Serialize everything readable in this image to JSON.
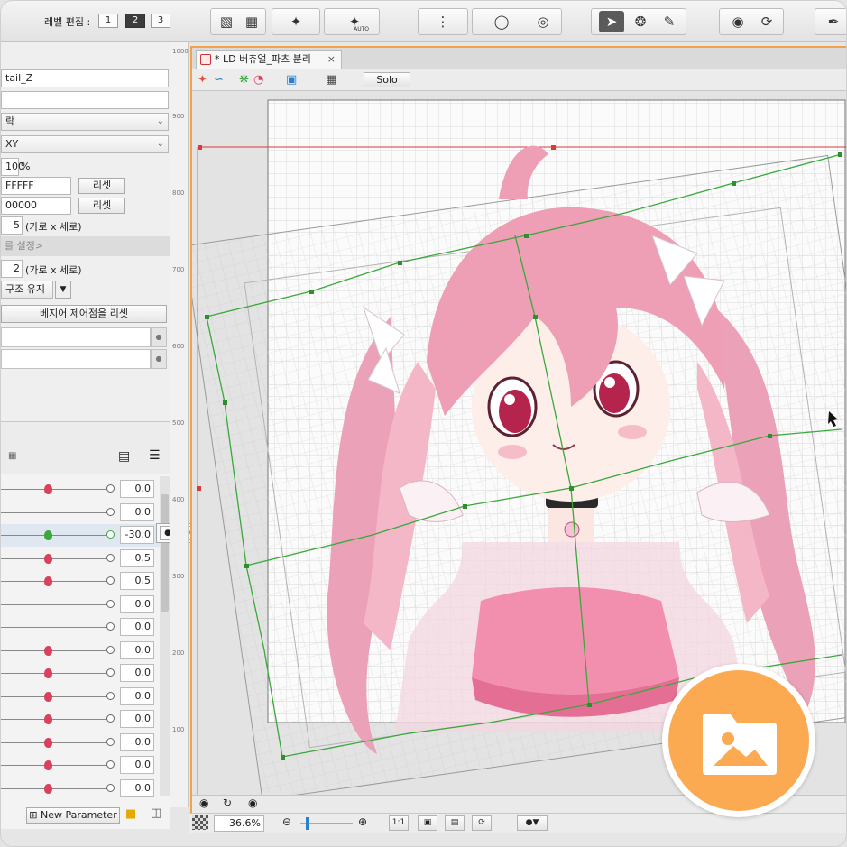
{
  "toolbar": {
    "level_edit_label": "레벨 편집 :",
    "levels": [
      "1",
      "2",
      "3"
    ],
    "active_level": "2",
    "auto_label": "AUTO"
  },
  "inspector": {
    "name_value": "tail_Z",
    "dropdown1": "락",
    "dropdown2": "XY",
    "opacity": "100",
    "opacity_unit": "%",
    "color1": "FFFFF",
    "color2": "00000",
    "reset_label": "리셋",
    "divisions1": "5",
    "divisions_unit": "(가로 x 세로)",
    "section_label": "를 설정>",
    "divisions2": "2",
    "structure_label": "구조 유지",
    "bezier_reset_label": "베지어 제어점을 리셋"
  },
  "parameters": {
    "values": [
      "0.0",
      "0.0",
      "-30.0",
      "0.5",
      "0.5",
      "0.0",
      "0.0",
      "0.0",
      "0.0",
      "0.0",
      "0.0",
      "0.0",
      "0.0",
      "0.0"
    ],
    "new_parameter_label": "New Parameter"
  },
  "ruler": {
    "ticks": [
      "1000",
      "900",
      "800",
      "700",
      "600",
      "500",
      "400",
      "300",
      "200",
      "100"
    ]
  },
  "view": {
    "tab_title": "* LD 버츄얼_파츠 분리",
    "tab_close": "×",
    "solo_label": "Solo"
  },
  "status": {
    "zoom": "36.6",
    "zoom_unit": "%",
    "ratio_label": "1:1"
  },
  "colors": {
    "accent": "#f2a24c",
    "knob": "#d9415c",
    "active_knob": "#3aa83a",
    "badge": "#fbaa52"
  }
}
